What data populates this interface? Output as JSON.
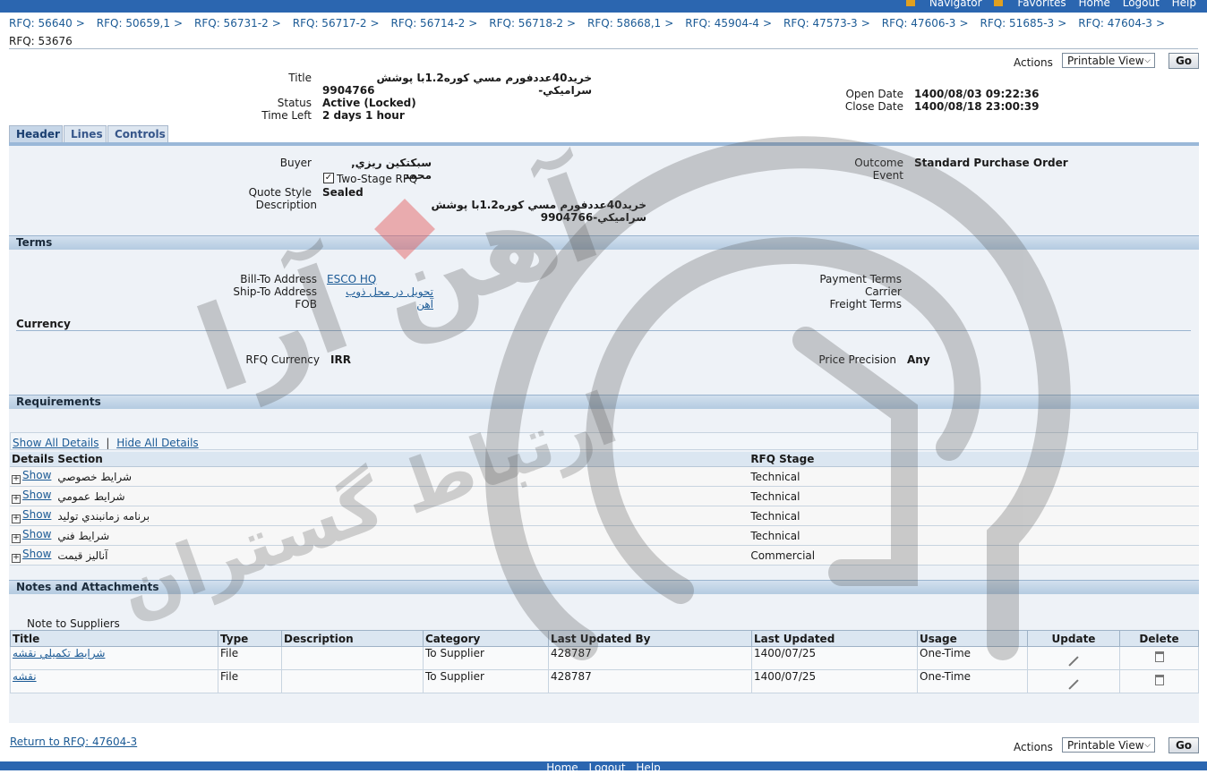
{
  "topnav": {
    "navigator": "Navigator",
    "favorites": "Favorites",
    "home": "Home",
    "logout": "Logout",
    "help": "Help"
  },
  "breadcrumbs": [
    "RFQ: 56640",
    "RFQ: 50659,1",
    "RFQ: 56731-2",
    "RFQ: 56717-2",
    "RFQ: 56714-2",
    "RFQ: 56718-2",
    "RFQ: 58668,1",
    "RFQ: 45904-4",
    "RFQ: 47573-3",
    "RFQ: 47606-3",
    "RFQ: 51685-3",
    "RFQ: 47604-3"
  ],
  "breadcrumb_sep": ">",
  "page_title": "RFQ: 53676",
  "actions": {
    "label": "Actions",
    "selected": "Printable View",
    "go": "Go"
  },
  "summary": {
    "title_label": "Title",
    "title_value_1": "خريد40عددفورم مسي كوره1.2با پوشش سراميكي-",
    "title_value_2": "9904766",
    "status_label": "Status",
    "status_value": "Active (Locked)",
    "time_left_label": "Time Left",
    "time_left_value": "2 days 1 hour",
    "open_date_label": "Open Date",
    "open_date_value": "1400/08/03 09:22:36",
    "close_date_label": "Close Date",
    "close_date_value": "1400/08/18 23:00:39"
  },
  "tabs": [
    "Header",
    "Lines",
    "Controls"
  ],
  "header": {
    "buyer_label": "Buyer",
    "buyer_value": "سبكتكين ريزي, محمد",
    "two_stage_label": "Two-Stage RFQ",
    "quote_style_label": "Quote Style",
    "quote_style_value": "Sealed",
    "description_label": "Description",
    "description_value": "خريد40عددفورم مسي كوره1.2با پوشش سراميكي-9904766",
    "outcome_label": "Outcome",
    "outcome_value": "Standard Purchase Order",
    "event_label": "Event"
  },
  "terms": {
    "heading": "Terms",
    "bill_to_label": "Bill-To Address",
    "bill_to_value": "ESCO HQ",
    "ship_to_label": "Ship-To Address",
    "ship_to_value": "تحويل در محل ذوب آهن",
    "fob_label": "FOB",
    "payment_terms_label": "Payment Terms",
    "carrier_label": "Carrier",
    "freight_terms_label": "Freight Terms"
  },
  "currency": {
    "heading": "Currency",
    "rfq_currency_label": "RFQ Currency",
    "rfq_currency_value": "IRR",
    "price_precision_label": "Price Precision",
    "price_precision_value": "Any"
  },
  "requirements": {
    "heading": "Requirements",
    "show_all": "Show All Details",
    "hide_all": "Hide All Details",
    "columns": [
      "Details",
      "Section",
      "RFQ Stage"
    ],
    "show_label": "Show",
    "rows": [
      {
        "section": "شرايط خصوصي",
        "stage": "Technical"
      },
      {
        "section": "شرايط عمومي",
        "stage": "Technical"
      },
      {
        "section": "برنامه زمانبندي توليد",
        "stage": "Technical"
      },
      {
        "section": "شرايط فني",
        "stage": "Technical"
      },
      {
        "section": "آناليز قيمت",
        "stage": "Commercial"
      }
    ]
  },
  "notes": {
    "heading": "Notes and Attachments",
    "note_label": "Note to Suppliers",
    "columns": [
      "Title",
      "Type",
      "Description",
      "Category",
      "Last Updated By",
      "Last Updated",
      "Usage",
      "Update",
      "Delete"
    ],
    "rows": [
      {
        "title": "شرايط تكميلي نقشه",
        "type": "File",
        "description": "",
        "category": "To Supplier",
        "updated_by": "428787",
        "updated": "1400/07/25",
        "usage": "One-Time"
      },
      {
        "title": "نقشه",
        "type": "File",
        "description": "",
        "category": "To Supplier",
        "updated_by": "428787",
        "updated": "1400/07/25",
        "usage": "One-Time"
      }
    ]
  },
  "return_link": "Return to RFQ: 47604-3",
  "footer": {
    "home": "Home",
    "logout": "Logout",
    "help": "Help"
  },
  "watermark": {
    "text_1": "آهن آرا",
    "text_2": "ارتباط گستران"
  }
}
